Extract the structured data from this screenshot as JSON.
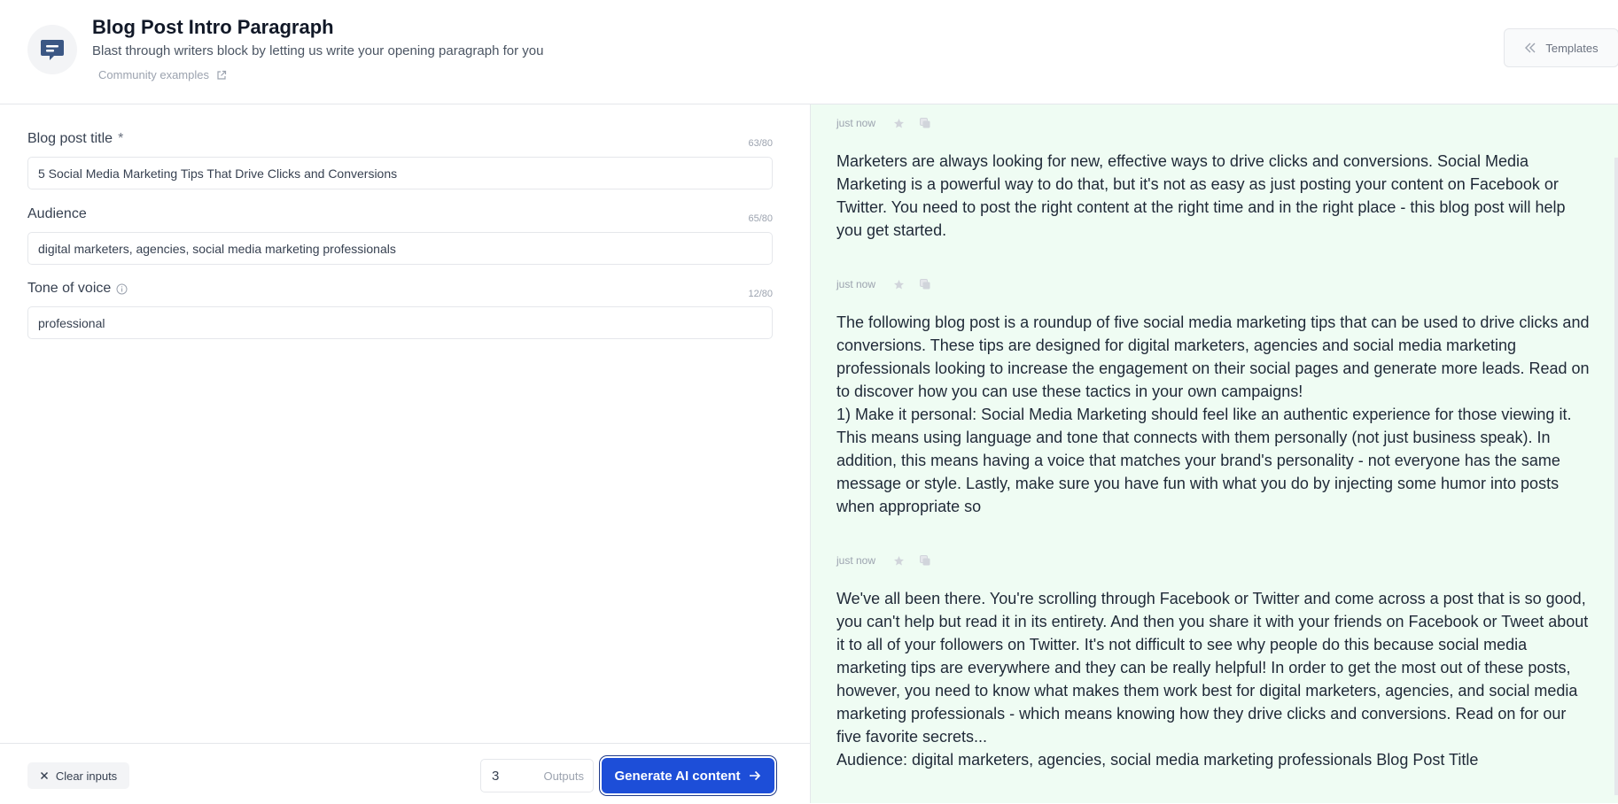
{
  "header": {
    "title": "Blog Post Intro Paragraph",
    "subtitle": "Blast through writers block by letting us write your opening paragraph for you",
    "community_link": "Community examples",
    "templates_label": "Templates"
  },
  "form": {
    "fields": [
      {
        "label": "Blog post title",
        "required_mark": "*",
        "counter": "63/80",
        "value": "5 Social Media Marketing Tips That Drive Clicks and Conversions"
      },
      {
        "label": "Audience",
        "counter": "65/80",
        "value": "digital marketers, agencies, social media marketing professionals"
      },
      {
        "label": "Tone of voice",
        "counter": "12/80",
        "value": "professional"
      }
    ]
  },
  "footer": {
    "clear_label": "Clear inputs",
    "outputs_value": "3",
    "outputs_label": "Outputs",
    "generate_label": "Generate AI content"
  },
  "outputs": [
    {
      "time": "just now",
      "text": "Marketers are always looking for new, effective ways to drive clicks and conversions. Social Media Marketing is a powerful way to do that, but it's not as easy as just posting your content on Facebook or Twitter. You need to post the right content at the right time and in the right place - this blog post will help you get started."
    },
    {
      "time": "just now",
      "text": "The following blog post is a roundup of five social media marketing tips that can be used to drive clicks and conversions. These tips are designed for digital marketers, agencies and social media marketing professionals looking to increase the engagement on their social pages and generate more leads. Read on to discover how you can use these tactics in your own campaigns!\n1) Make it personal: Social Media Marketing should feel like an authentic experience for those viewing it. This means using language and tone that connects with them personally (not just business speak). In addition, this means having a voice that matches your brand's personality - not everyone has the same message or style. Lastly, make sure you have fun with what you do by injecting some humor into posts when appropriate so"
    },
    {
      "time": "just now",
      "text": "We've all been there. You're scrolling through Facebook or Twitter and come across a post that is so good, you can't help but read it in its entirety. And then you share it with your friends on Facebook or Tweet about it to all of your followers on Twitter. It's not difficult to see why people do this because social media marketing tips are everywhere and they can be really helpful! In order to get the most out of these posts, however, you need to know what makes them work best for digital marketers, agencies, and social media marketing professionals - which means knowing how they drive clicks and conversions. Read on for our five favorite secrets...\nAudience: digital marketers, agencies, social media marketing professionals   Blog Post Title"
    }
  ],
  "colors": {
    "accent": "#1d4ed8",
    "output_bg": "#effcf3"
  }
}
